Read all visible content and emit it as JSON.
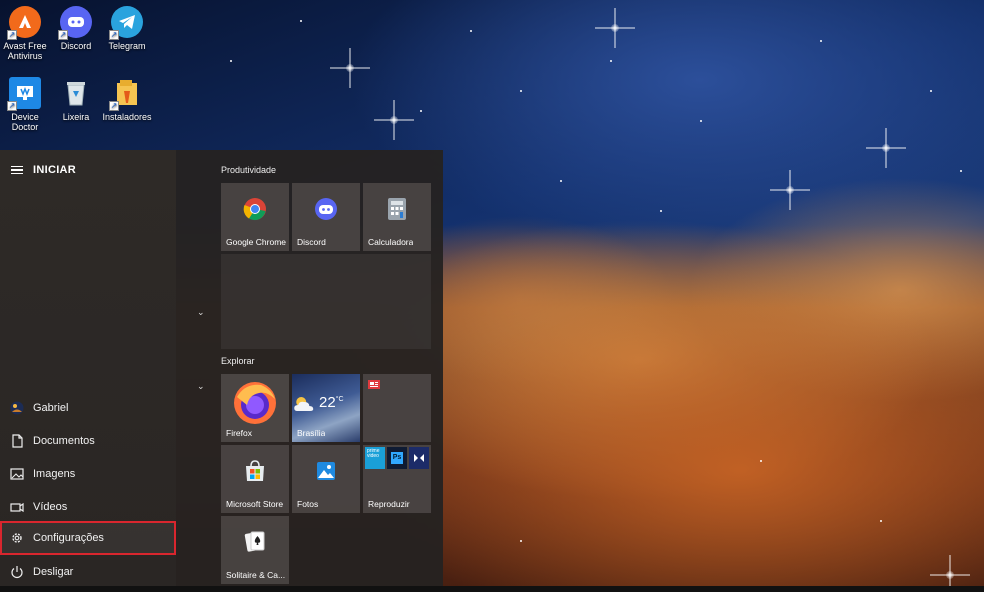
{
  "desktop": {
    "icons": [
      {
        "label": "Avast Free Antivirus",
        "icon": "avast-icon",
        "color": "#f26a1b"
      },
      {
        "label": "Discord",
        "icon": "discord-icon",
        "color": "#5865f2"
      },
      {
        "label": "Telegram",
        "icon": "telegram-icon",
        "color": "#2aa3de"
      },
      {
        "label": "Device Doctor",
        "icon": "device-doctor-icon",
        "color": "#1e88e5"
      },
      {
        "label": "Lixeira",
        "icon": "recycle-bin-icon",
        "color": "#cfd8dc"
      },
      {
        "label": "Instaladores",
        "icon": "folder-icon",
        "color": "#f5c451"
      }
    ]
  },
  "start_menu": {
    "title": "INICIAR",
    "nav": [
      {
        "label": "Gabriel",
        "icon": "user-avatar-icon"
      },
      {
        "label": "Documentos",
        "icon": "document-icon"
      },
      {
        "label": "Imagens",
        "icon": "image-icon"
      },
      {
        "label": "Vídeos",
        "icon": "video-icon"
      },
      {
        "label": "Configurações",
        "icon": "gear-icon",
        "highlighted": true
      },
      {
        "label": "Desligar",
        "icon": "power-icon"
      }
    ],
    "groups": [
      {
        "label": "Produtividade",
        "tiles": [
          {
            "label": "Google Chrome",
            "icon": "chrome-icon"
          },
          {
            "label": "Discord",
            "icon": "discord-icon"
          },
          {
            "label": "Calculadora",
            "icon": "calculator-icon"
          }
        ]
      },
      {
        "label": "Explorar",
        "tiles": [
          {
            "label": "Firefox",
            "icon": "firefox-icon"
          },
          {
            "label": "Brasília",
            "icon": "weather-icon",
            "temperature": "22",
            "unit": "°C"
          },
          {
            "label": "",
            "icon": "news-icon"
          },
          {
            "label": "Microsoft Store",
            "icon": "store-icon"
          },
          {
            "label": "Fotos",
            "icon": "photos-icon"
          },
          {
            "label": "Reproduzir",
            "icon": "play-folder-icon"
          },
          {
            "label": "Solitaire & Ca...",
            "icon": "solitaire-icon"
          }
        ]
      }
    ]
  },
  "colors": {
    "highlight_border": "#d9262e",
    "menu_bg": "#252221",
    "tile_bg": "#4e4846"
  }
}
